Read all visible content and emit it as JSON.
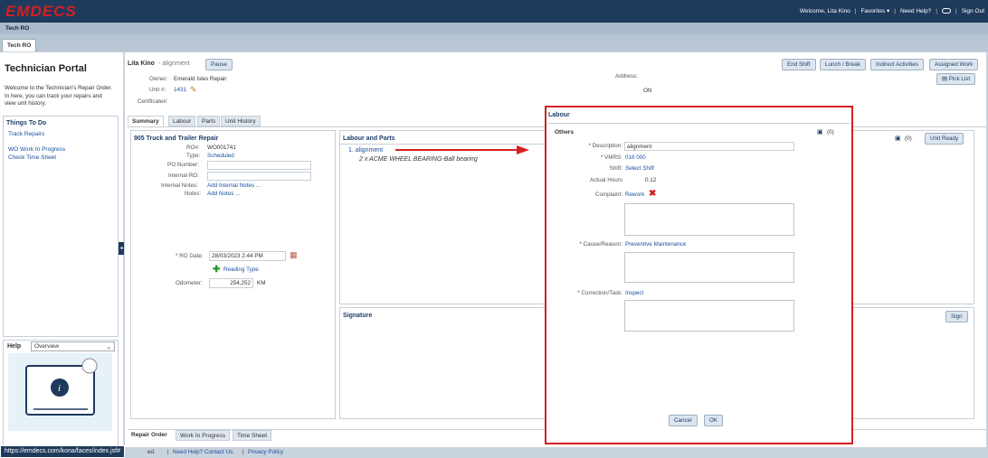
{
  "app": {
    "logo": "EMDECS"
  },
  "topnav": {
    "welcome": "Welcome, Lita Kino",
    "favorites": "Favorites ▾",
    "help": "Need Help?",
    "signout": "Sign Out"
  },
  "subbar": {
    "title": "Tech RO"
  },
  "tab": {
    "label": "Tech RO"
  },
  "portal": {
    "title": "Technician Portal",
    "intro": "Welcome to the Technician's Repair Order. In here, you can track your repairs and view unit history.",
    "todo_head": "Things To Do",
    "todo": [
      "Track Repairs",
      "WO Work In Progress",
      "Check Time Sheet"
    ],
    "help_label": "Help",
    "help_select": "Overview"
  },
  "header": {
    "tech": "Lita Kino",
    "job": "- alignment",
    "pause": "Pause",
    "owner_lbl": "Owner:",
    "owner": "Emerald Isles Repair",
    "unit_lbl": "Unit #:",
    "unit": "1431",
    "cert_lbl": "Certificate#:",
    "address_lbl": "Address:",
    "on": "ON",
    "actions": [
      "End Shift",
      "Lunch / Break",
      "Indirect Activities",
      "Assigned Work"
    ],
    "picklist": "Pick List"
  },
  "subtabs": [
    "Summary",
    "Labour",
    "Parts",
    "Unit History"
  ],
  "summary": {
    "title": "905 Truck and Trailer Repair",
    "ro_lbl": "RO#:",
    "ro": "WO001741",
    "type_lbl": "Type:",
    "type": "Scheduled",
    "po_lbl": "PO Number:",
    "irm_lbl": "Internal RO:",
    "inotes_lbl": "Internal Notes:",
    "inotes": "Add Internal Notes ...",
    "notes_lbl": "Notes:",
    "notes": "Add Notes ...",
    "rodate_lbl": "* RO Date:",
    "rodate": "28/03/2023 2:44 PM",
    "reading": "Reading Type",
    "odo_lbl": "Odometer:",
    "odo": "254,252",
    "odo_unit": "KM"
  },
  "labour": {
    "title": "Labour and Parts",
    "item": "1. alignment",
    "part": "2 x ACME WHEEL BEARING-Ball bearing",
    "count": "(0)",
    "unitready": "Unit Ready"
  },
  "signature": {
    "title": "Signature",
    "sign": "Sign"
  },
  "bottomtabs": [
    "Repair Order",
    "Work In Progress",
    "Time Sheet"
  ],
  "footer": {
    "rights": "ed.",
    "help": "Need Help? Contact Us.",
    "privacy": "Privacy Policy"
  },
  "status": {
    "url": "https://emdecs.com/kona/faces/index.jsf#"
  },
  "modal": {
    "title": "Labour",
    "section": "Others",
    "count": "(0)",
    "desc_lbl": "* Description:",
    "desc": "alignment",
    "vmrs_lbl": "* VMRS:",
    "vmrs": "016 000",
    "shift_lbl": "Shift:",
    "shift": "Select Shift",
    "hours_lbl": "Actual Hours",
    "hours": "0.12",
    "complaint_lbl": "Complaint:",
    "complaint": "Rework",
    "cause_lbl": "* Cause/Reason:",
    "cause": "Preventive Maintenance",
    "correction_lbl": "* Correction/Task:",
    "correction": "Inspect",
    "cancel": "Cancel",
    "ok": "OK"
  }
}
